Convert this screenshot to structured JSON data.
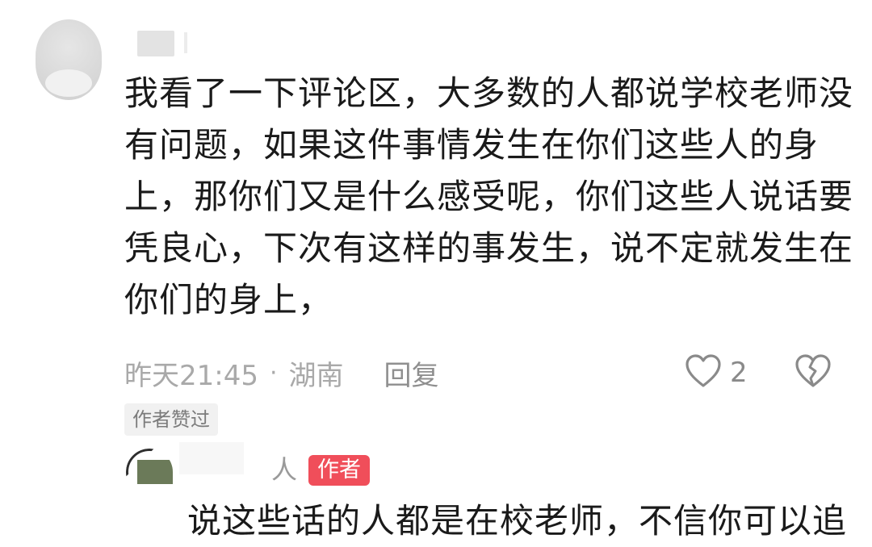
{
  "comment": {
    "lines": [
      "我看了一下评论区，大多数的人都说学校老师没",
      "有问题，如果这件事情发生在你们这些人的身",
      "上，那你们又是什么感受呢，你们这些人说话要",
      "凭良心，下次有这样的事发生，说不定就发生在",
      "你们的身上，"
    ],
    "time": "昨天21:45",
    "dot": "·",
    "location": "湖南",
    "reply_label": "回复",
    "like_count": "2",
    "author_liked": "作者赞过"
  },
  "reply": {
    "username": "人",
    "author_badge": "作者",
    "text": "说这些话的人都是在校老师，不信你可以追"
  },
  "colors": {
    "badge": "#f04e5a",
    "meta_gray": "#a9a9a9"
  },
  "icons": {
    "like": "heart-outline-icon",
    "dislike": "broken-heart-icon"
  }
}
